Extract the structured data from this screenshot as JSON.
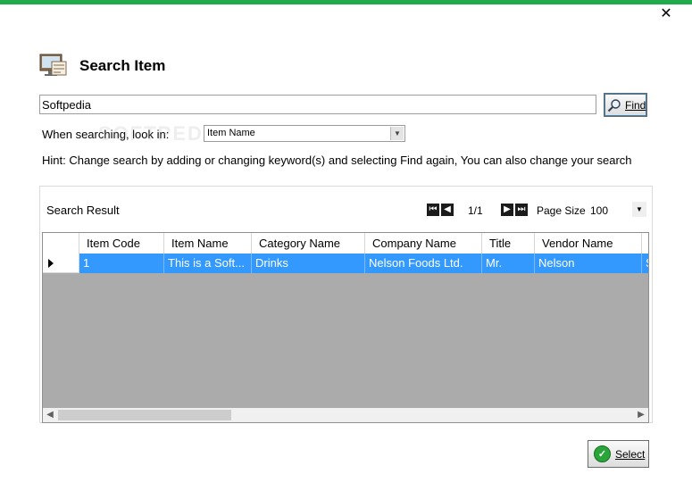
{
  "window": {
    "accent": "#1fab4b",
    "close_glyph": "✕"
  },
  "header": {
    "title": "Search Item",
    "icon": "search-item-icon"
  },
  "search": {
    "value": "Softpedia",
    "find_label": "Find"
  },
  "lookin": {
    "label": "When searching, look in:",
    "selected": "Item Name"
  },
  "watermark": "SOFTPEDIA",
  "hint": "Hint: Change search by adding or changing keyword(s) and selecting Find again, You can also change your search",
  "results": {
    "label": "Search Result",
    "page_info": "1/1",
    "page_size_label": "Page Size",
    "page_size": "100",
    "columns": [
      "Item Code",
      "Item Name",
      "Category Name",
      "Company Name",
      "Title",
      "Vendor Name",
      "A"
    ],
    "rows": [
      [
        "1",
        "This is a Soft...",
        "Drinks",
        "Nelson Foods Ltd.",
        "Mr.",
        "Nelson",
        "S"
      ]
    ],
    "selected_row_color": "#3399ff"
  },
  "footer": {
    "select_label": "Select"
  }
}
